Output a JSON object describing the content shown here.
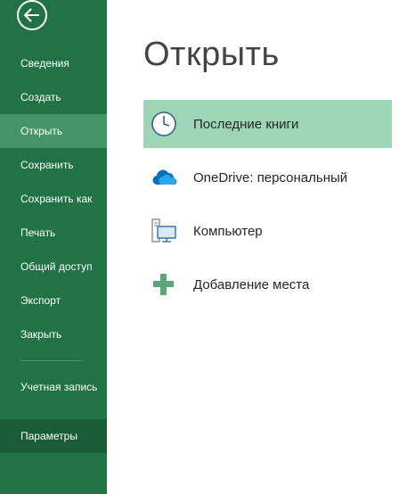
{
  "sidebar": {
    "back_icon": "back-arrow-icon",
    "items": [
      {
        "label": "Сведения"
      },
      {
        "label": "Создать"
      },
      {
        "label": "Открыть"
      },
      {
        "label": "Сохранить"
      },
      {
        "label": "Сохранить как"
      },
      {
        "label": "Печать"
      },
      {
        "label": "Общий доступ"
      },
      {
        "label": "Экспорт"
      },
      {
        "label": "Закрыть"
      }
    ],
    "account_label": "Учетная запись",
    "options_label": "Параметры"
  },
  "main": {
    "title": "Открыть",
    "locations": [
      {
        "label": "Последние книги",
        "icon": "clock-icon"
      },
      {
        "label": "OneDrive: персональный",
        "icon": "onedrive-cloud-icon"
      },
      {
        "label": "Компьютер",
        "icon": "computer-icon"
      },
      {
        "label": "Добавление места",
        "icon": "add-place-icon"
      }
    ]
  },
  "colors": {
    "sidebar_bg": "#217346",
    "sidebar_active": "#439467",
    "sidebar_dark": "#1a5c38",
    "selected_location": "#9fd5b7"
  }
}
